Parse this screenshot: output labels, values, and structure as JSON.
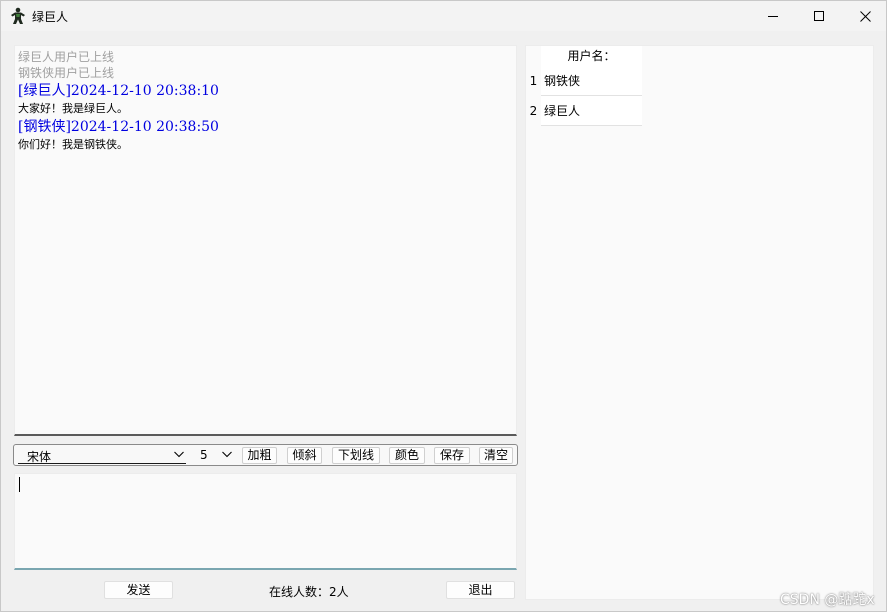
{
  "window": {
    "title": "绿巨人",
    "icon": "hulk-figure-icon"
  },
  "messages": [
    {
      "kind": "system",
      "text": "绿巨人用户已上线"
    },
    {
      "kind": "system",
      "text": "钢铁侠用户已上线"
    },
    {
      "kind": "header",
      "text": "[绿巨人]2024-12-10 20:38:10"
    },
    {
      "kind": "body",
      "text": "大家好！我是绿巨人。"
    },
    {
      "kind": "header",
      "text": "[钢铁侠]2024-12-10 20:38:50"
    },
    {
      "kind": "body",
      "text": "你们好！我是钢铁侠。"
    }
  ],
  "toolbar": {
    "font_family": "宋体",
    "font_size": "5",
    "bold_label": "加粗",
    "italic_label": "倾斜",
    "underline_label": "下划线",
    "color_label": "颜色",
    "save_label": "保存",
    "clear_label": "清空"
  },
  "input": {
    "value": ""
  },
  "footer": {
    "send_label": "发送",
    "online_count": "在线人数：2人",
    "exit_label": "退出"
  },
  "users": {
    "header": "用户名：",
    "rows": [
      {
        "num": "1",
        "name": "钢铁侠"
      },
      {
        "num": "2",
        "name": "绿巨人"
      }
    ]
  },
  "watermark": "CSDN @踮跎x",
  "colors": {
    "header_text": "#0000e0",
    "system_text": "#a0a0a0"
  }
}
